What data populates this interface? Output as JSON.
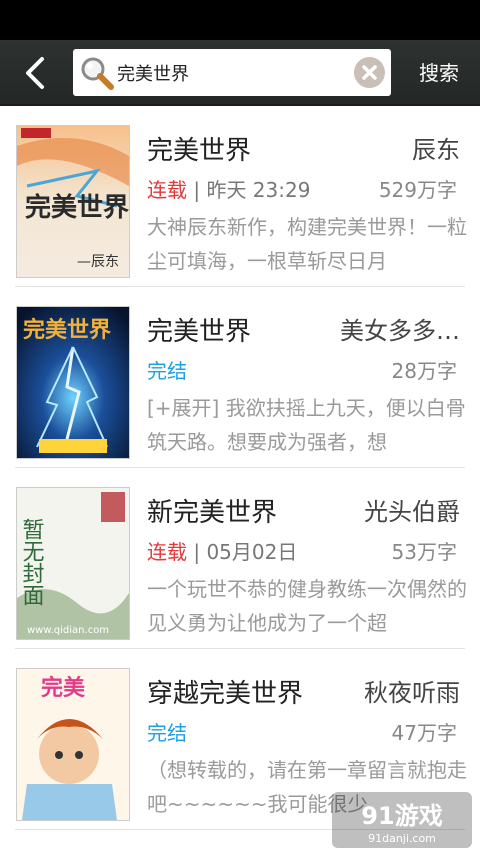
{
  "header": {
    "search_value": "完美世界",
    "search_label": "搜索"
  },
  "books": [
    {
      "title": "完美世界",
      "author": "辰东",
      "status": "连载",
      "status_color": "red",
      "separator": " | ",
      "updated": "昨天 23:29",
      "words": "529万字",
      "desc": "大神辰东新作，构建完美世界！一粒尘可填海，一根草斩尽日月",
      "cover_text": "完美世界"
    },
    {
      "title": "完美世界",
      "author": "美女多多…",
      "status": "完结",
      "status_color": "blue",
      "separator": "",
      "updated": "",
      "words": "28万字",
      "desc": "[+展开] 我欲扶摇上九天，便以白骨筑天路。想要成为强者，想",
      "cover_text": "完美世界"
    },
    {
      "title": "新完美世界",
      "author": "光头伯爵",
      "status": "连载",
      "status_color": "red",
      "separator": " | ",
      "updated": "05月02日",
      "words": "53万字",
      "desc": "一个玩世不恭的健身教练一次偶然的见义勇为让他成为了一个超",
      "cover_text": "暂无封面"
    },
    {
      "title": "穿越完美世界",
      "author": "秋夜听雨",
      "status": "完结",
      "status_color": "blue",
      "separator": "",
      "updated": "",
      "words": "47万字",
      "desc": "（想转载的，请在第一章留言就抱走吧~~~~~~我可能很少",
      "cover_text": "完美"
    }
  ],
  "watermark": {
    "text": "91游戏",
    "sub": "91danji.com"
  }
}
